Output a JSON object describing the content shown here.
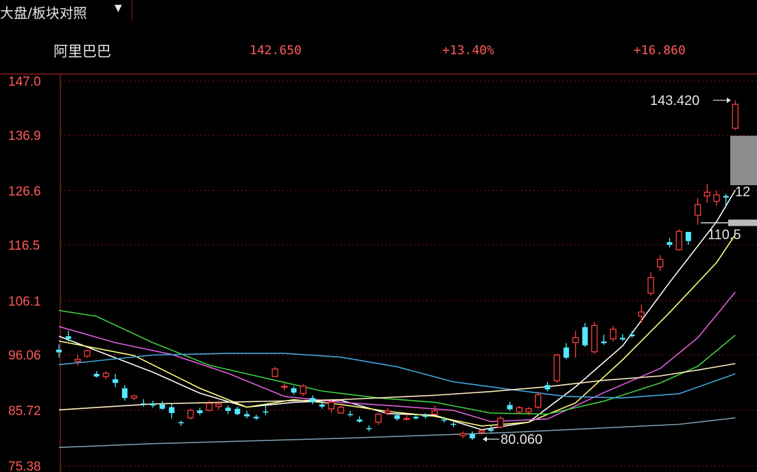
{
  "toolbar": {
    "title": "大盘/板块对照",
    "caret": "▼"
  },
  "info": {
    "stock_name": "阿里巴巴",
    "price": "142.650",
    "change_pct": "+13.40%",
    "change": "+16.860"
  },
  "colors": {
    "up": "#ff4040",
    "down": "#54e8ff",
    "grid": "#8a1a1a",
    "axis_label": "#ff5a5a",
    "ma_white": "#ffffff",
    "ma_yellow": "#ffff80",
    "ma_magenta": "#e060e0",
    "ma_green": "#40d040",
    "ma_blue": "#40a8e0",
    "ma_cream": "#fff0c0",
    "ma_grey": "#7a9aaa"
  },
  "chart_data": {
    "type": "candlestick",
    "y_ticks": [
      "147.0",
      "136.9",
      "126.6",
      "116.5",
      "106.1",
      "96.06",
      "85.72",
      "75.38"
    ],
    "ylim": [
      75.38,
      147.0
    ],
    "grid": true,
    "annotations": {
      "high": "143.420",
      "low": "80.060",
      "right_upper": "12",
      "right_lower": "110.5"
    },
    "candles": [
      [
        97,
        98,
        95.5,
        96.5
      ],
      [
        99.5,
        100.5,
        98.5,
        99
      ],
      [
        94.8,
        96,
        94,
        95.2
      ],
      [
        95.8,
        97,
        95.5,
        96.8
      ],
      [
        92.5,
        93,
        91.8,
        92
      ],
      [
        92,
        93,
        91.5,
        92.6
      ],
      [
        91.5,
        92.5,
        90,
        90.8
      ],
      [
        89.8,
        90.4,
        87.5,
        88
      ],
      [
        88,
        88.5,
        87.6,
        88.4
      ],
      [
        87,
        87.8,
        86.4,
        86.8
      ],
      [
        87,
        87.5,
        86.2,
        86.6
      ],
      [
        86.8,
        87.4,
        85.8,
        86
      ],
      [
        86.3,
        86.9,
        84.2,
        85.2
      ],
      [
        83.5,
        83.8,
        82.8,
        83.3
      ],
      [
        84.3,
        86,
        84,
        85.7
      ],
      [
        85.7,
        86.2,
        84.8,
        85.2
      ],
      [
        85.7,
        87.5,
        85.5,
        87
      ],
      [
        86.4,
        87.5,
        85.8,
        86.9
      ],
      [
        86.2,
        86.6,
        85,
        85.6
      ],
      [
        86,
        86.4,
        84.8,
        85
      ],
      [
        85,
        85.6,
        84.2,
        84.6
      ],
      [
        84.5,
        84.9,
        83.9,
        84.2
      ],
      [
        85.5,
        86.8,
        84.8,
        85.3
      ],
      [
        92,
        93.8,
        92.6,
        93.4
      ],
      [
        90,
        90.8,
        89.4,
        90.2
      ],
      [
        89.8,
        90.2,
        88.6,
        89
      ],
      [
        88.8,
        90.6,
        88.4,
        90.2
      ],
      [
        88,
        88.5,
        86.8,
        87.2
      ],
      [
        86.8,
        87.3,
        86,
        86.4
      ],
      [
        86,
        87.6,
        85.2,
        87.2
      ],
      [
        85.2,
        86.6,
        85,
        86.3
      ],
      [
        85,
        85.6,
        84.5,
        84.8
      ],
      [
        84,
        84.6,
        83.4,
        83.6
      ],
      [
        82.4,
        82.9,
        81.8,
        82.2
      ],
      [
        83.5,
        85.3,
        83,
        85
      ],
      [
        85.2,
        86.2,
        84.8,
        85.6
      ],
      [
        84.8,
        85.4,
        83.8,
        84.1
      ],
      [
        84.2,
        85,
        83.8,
        84.2
      ],
      [
        84.5,
        85,
        84,
        84.2
      ],
      [
        84.8,
        85.2,
        84.2,
        84.5
      ],
      [
        85,
        86.6,
        84.8,
        85.6
      ],
      [
        84,
        84.5,
        83.4,
        83.8
      ],
      [
        83.2,
        83.7,
        82.6,
        83
      ],
      [
        81,
        81.8,
        80.5,
        81.4
      ],
      [
        81.3,
        81.8,
        80.2,
        80.5
      ],
      [
        81.6,
        82.2,
        81.2,
        81.9
      ],
      [
        82.2,
        82.8,
        81.6,
        81.9
      ],
      [
        82.6,
        84.6,
        82.3,
        84.2
      ],
      [
        86.7,
        87.3,
        85.6,
        85.9
      ],
      [
        85.4,
        86.5,
        85.1,
        86.2
      ],
      [
        85.4,
        86.3,
        84.8,
        86
      ],
      [
        86.3,
        89.2,
        86,
        88.6
      ],
      [
        90.4,
        91,
        89.2,
        89.6
      ],
      [
        91.2,
        96.2,
        90.8,
        96
      ],
      [
        97.4,
        98.2,
        95.2,
        95.5
      ],
      [
        98.3,
        100.5,
        95.5,
        99.2
      ],
      [
        101.2,
        102,
        97.5,
        97.8
      ],
      [
        96.6,
        102.2,
        96.2,
        101.5
      ],
      [
        98.5,
        99.8,
        97.9,
        98.2
      ],
      [
        99,
        101.4,
        98.5,
        100.8
      ],
      [
        99.2,
        99.9,
        98.6,
        98.9
      ],
      [
        99.8,
        100.5,
        99.2,
        99.5
      ],
      [
        103.2,
        105.4,
        102,
        104
      ],
      [
        107.5,
        111.4,
        107.1,
        110.4
      ],
      [
        112.4,
        114.6,
        111.6,
        113.8
      ],
      [
        117,
        117.8,
        116,
        116.5
      ],
      [
        115.6,
        119.4,
        115.4,
        119
      ],
      [
        118.9,
        118.9,
        116.5,
        117.2
      ],
      [
        122,
        125.2,
        120.2,
        124
      ],
      [
        125.6,
        127.8,
        124.3,
        126.3
      ],
      [
        124.6,
        126.6,
        123.8,
        125.8
      ],
      [
        125.6,
        126,
        123.9,
        125.3
      ],
      [
        138.2,
        143.4,
        137.9,
        142.65
      ]
    ],
    "ma_lines": {
      "ma_white": [
        [
          0,
          99.5
        ],
        [
          10,
          92.8
        ],
        [
          15,
          88.9
        ],
        [
          20,
          86.3
        ],
        [
          25,
          87.2
        ],
        [
          30,
          87.6
        ],
        [
          35,
          85.1
        ],
        [
          40,
          84.8
        ],
        [
          45,
          82.1
        ],
        [
          50,
          83.5
        ],
        [
          55,
          90.1
        ],
        [
          60,
          97.7
        ],
        [
          65,
          109.5
        ],
        [
          70,
          120.8
        ],
        [
          72,
          126.7
        ]
      ],
      "ma_yellow": [
        [
          0,
          98.6
        ],
        [
          8,
          95.9
        ],
        [
          15,
          89.8
        ],
        [
          20,
          86.3
        ],
        [
          25,
          87.7
        ],
        [
          30,
          86.8
        ],
        [
          35,
          85.5
        ],
        [
          40,
          84.6
        ],
        [
          45,
          82.8
        ],
        [
          50,
          83.5
        ],
        [
          55,
          87.1
        ],
        [
          60,
          95.1
        ],
        [
          65,
          103.9
        ],
        [
          70,
          113.2
        ],
        [
          72,
          118.4
        ]
      ],
      "ma_magenta": [
        [
          0,
          101.3
        ],
        [
          6,
          98.3
        ],
        [
          12,
          96.1
        ],
        [
          18,
          92.6
        ],
        [
          24,
          88.3
        ],
        [
          30,
          87.2
        ],
        [
          36,
          86.5
        ],
        [
          42,
          85.7
        ],
        [
          46,
          83.6
        ],
        [
          52,
          84.1
        ],
        [
          58,
          89
        ],
        [
          64,
          93.5
        ],
        [
          68,
          99.2
        ],
        [
          72,
          107.7
        ]
      ],
      "ma_green": [
        [
          0,
          104.3
        ],
        [
          4,
          103.2
        ],
        [
          10,
          98.3
        ],
        [
          16,
          94.1
        ],
        [
          22,
          91.7
        ],
        [
          28,
          89.3
        ],
        [
          34,
          88
        ],
        [
          40,
          87.2
        ],
        [
          46,
          85.2
        ],
        [
          52,
          85
        ],
        [
          58,
          87.4
        ],
        [
          64,
          90.8
        ],
        [
          68,
          93.9
        ],
        [
          72,
          99.7
        ]
      ],
      "ma_blue": [
        [
          0,
          94.2
        ],
        [
          10,
          96
        ],
        [
          18,
          96.3
        ],
        [
          24,
          96.3
        ],
        [
          30,
          95.6
        ],
        [
          36,
          93.8
        ],
        [
          42,
          91
        ],
        [
          48,
          89.6
        ],
        [
          54,
          88.3
        ],
        [
          60,
          88
        ],
        [
          66,
          88.8
        ],
        [
          72,
          92.5
        ]
      ],
      "ma_cream": [
        [
          0,
          85.8
        ],
        [
          10,
          86.9
        ],
        [
          20,
          87.3
        ],
        [
          30,
          87.7
        ],
        [
          40,
          88.5
        ],
        [
          46,
          89.2
        ],
        [
          52,
          90.1
        ],
        [
          58,
          91.3
        ],
        [
          64,
          92.1
        ],
        [
          68,
          93.2
        ],
        [
          72,
          94.4
        ]
      ],
      "ma_grey": [
        [
          0,
          78.8
        ],
        [
          10,
          79.5
        ],
        [
          20,
          80
        ],
        [
          30,
          80.5
        ],
        [
          40,
          81.1
        ],
        [
          48,
          81.6
        ],
        [
          54,
          82.1
        ],
        [
          60,
          82.6
        ],
        [
          66,
          83.1
        ],
        [
          72,
          84.3
        ]
      ]
    }
  }
}
